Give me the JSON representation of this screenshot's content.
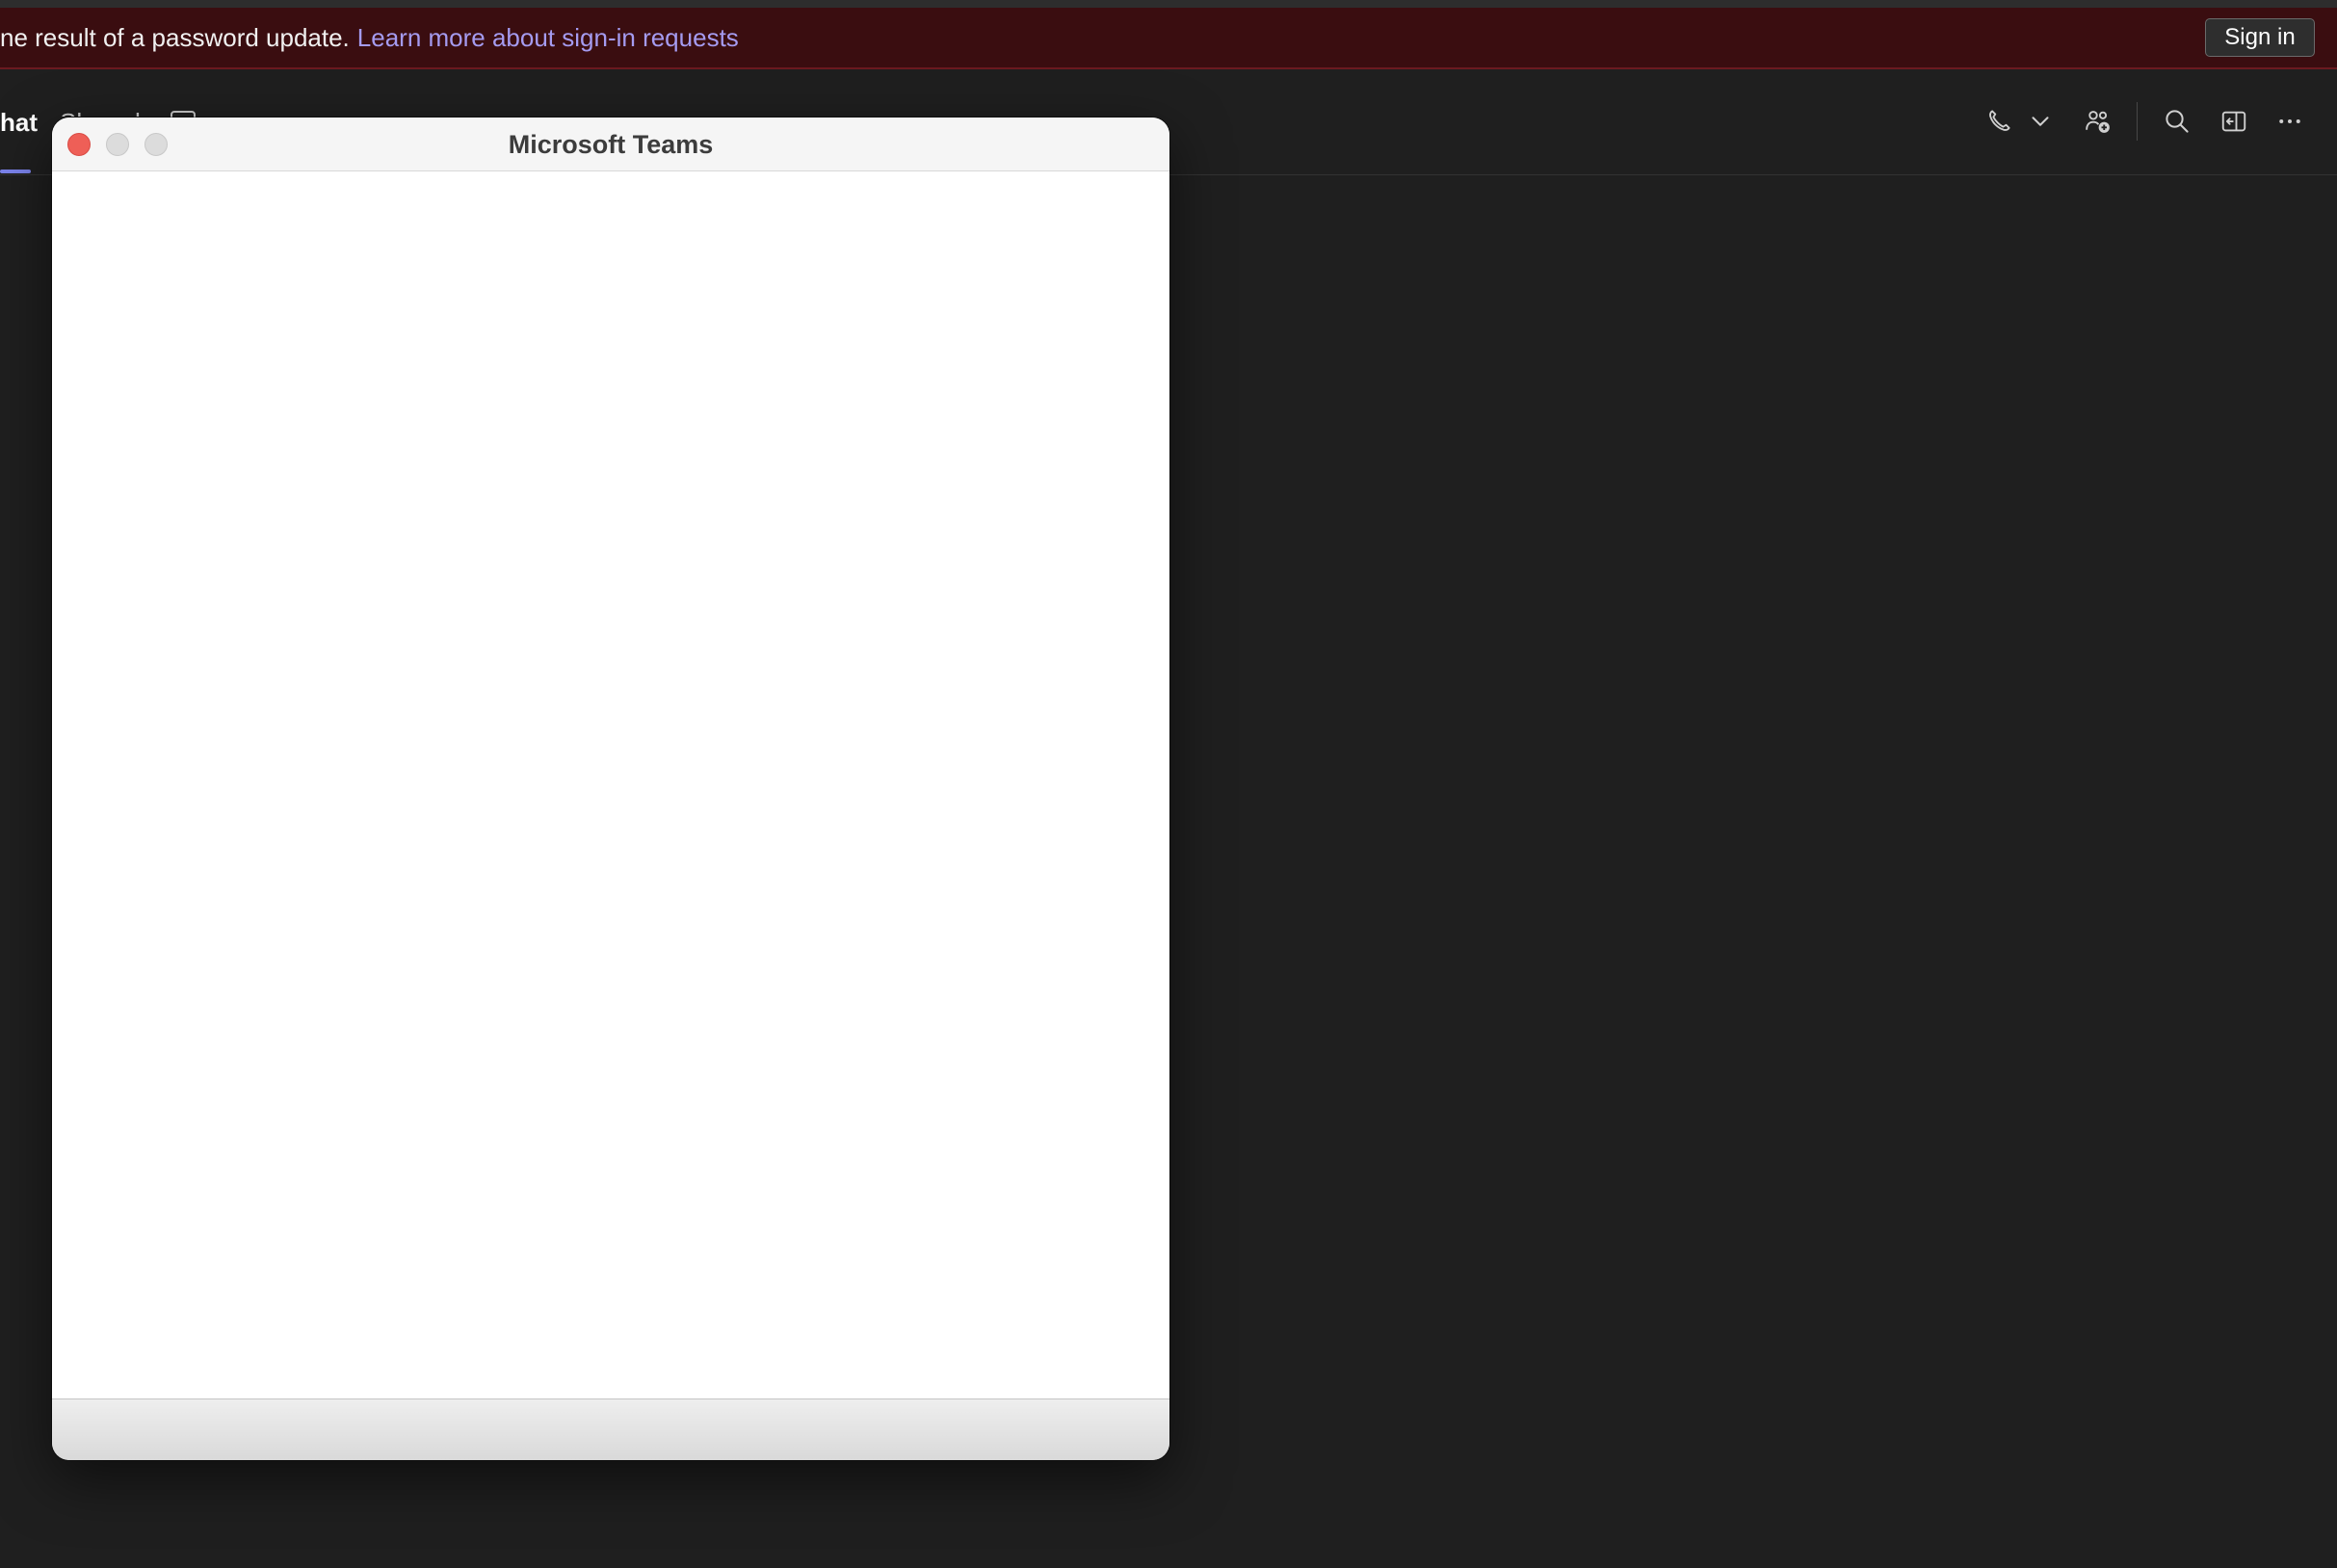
{
  "banner": {
    "message": "ne result of a password update.",
    "link_label": "Learn more about sign-in requests",
    "sign_in_label": "Sign in"
  },
  "chat_header": {
    "tabs": [
      {
        "label": "hat",
        "active": true
      },
      {
        "label": "Shared",
        "active": false
      }
    ],
    "actions": [
      {
        "icon": "phone-icon"
      },
      {
        "icon": "chevron-down-icon"
      },
      {
        "icon": "add-people-icon"
      },
      {
        "icon": "search-icon"
      },
      {
        "icon": "pop-out-chat-icon"
      },
      {
        "icon": "more-options-icon"
      }
    ]
  },
  "modal": {
    "title": "Microsoft Teams"
  },
  "colors": {
    "banner_bg": "#3a0d10",
    "link": "#a59bf0",
    "accent": "#7b83eb",
    "app_bg": "#1f1f1f"
  }
}
